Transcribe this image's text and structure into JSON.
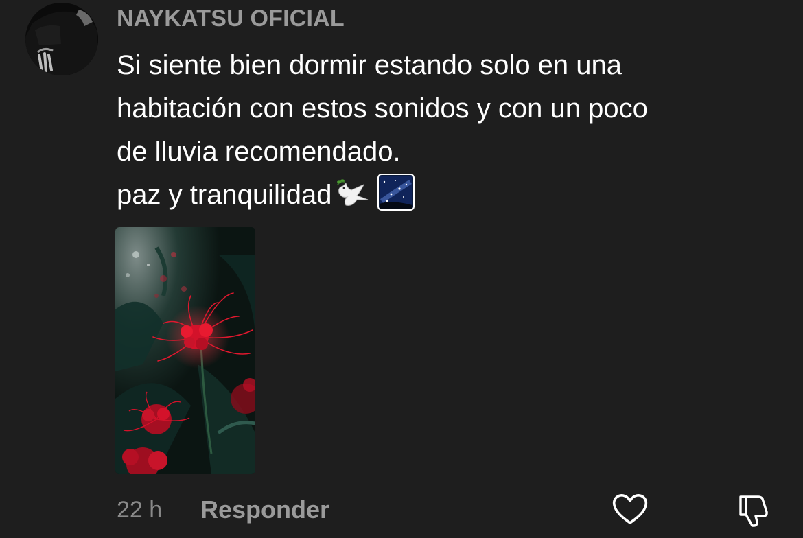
{
  "comment": {
    "username": "NAYKATSU OFICIAL",
    "text_lines": [
      "Si siente bien dormir estando solo en una",
      "habitación con estos sonidos y con un poco",
      "de lluvia recomendado.",
      "paz y tranquilidad"
    ],
    "emojis": [
      "dove-icon",
      "milky-way-icon"
    ],
    "time": "22 h",
    "reply_label": "Responder",
    "icons": {
      "like": "heart-outline-icon",
      "dislike": "thumbs-down-outline-icon"
    }
  },
  "colors": {
    "background": "#1e1e1e",
    "username": "#9a9a9a",
    "text": "#ffffff",
    "meta": "#8a8a8a",
    "flower_accent": "#d4142a"
  }
}
